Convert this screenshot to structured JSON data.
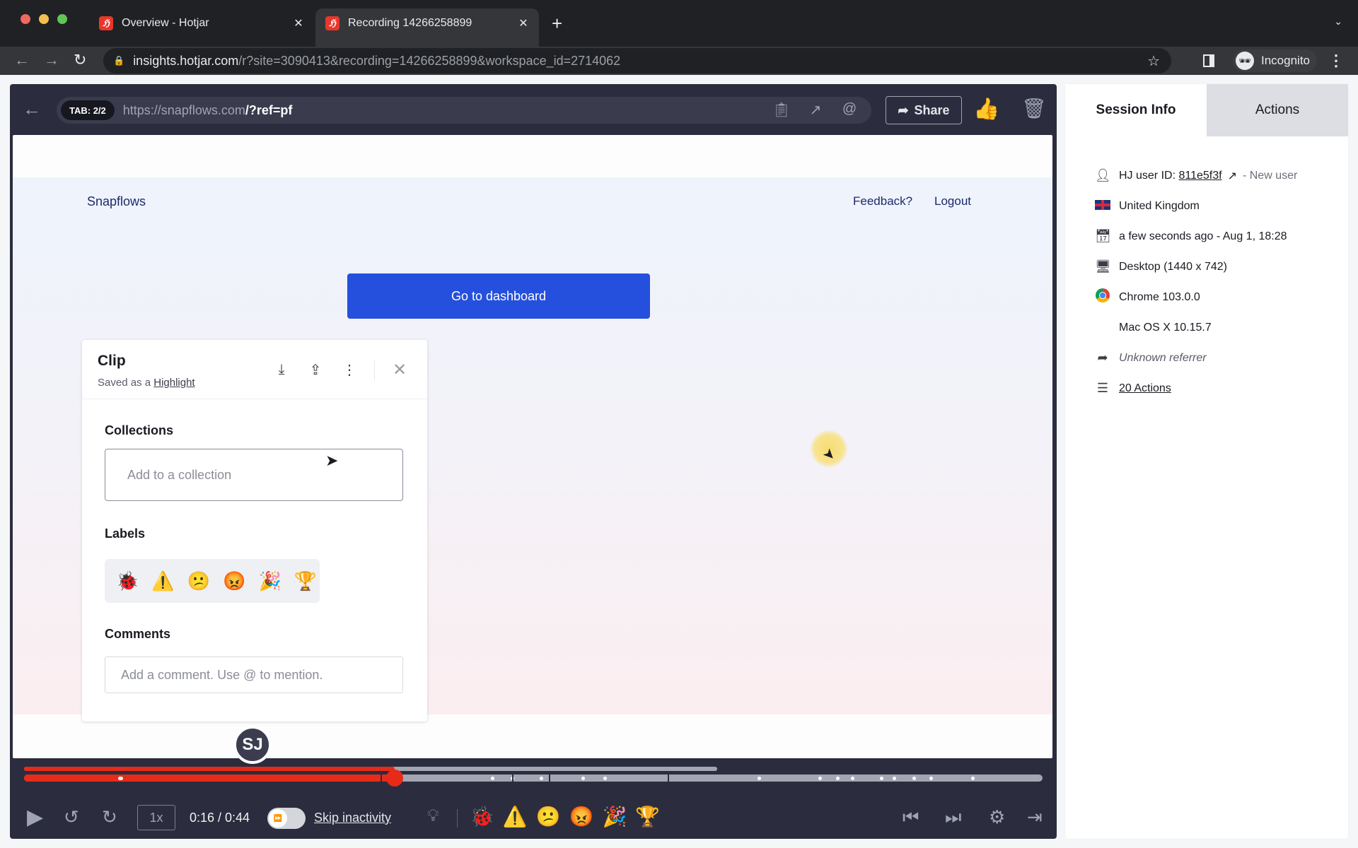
{
  "browser": {
    "tabs": [
      {
        "title": "Overview - Hotjar",
        "favicon": "hotjar-icon",
        "active": false
      },
      {
        "title": "Recording 14266258899",
        "favicon": "hotjar-icon",
        "active": true
      }
    ],
    "url_host": "insights.hotjar.com",
    "url_path": "/r?site=3090413&recording=14266258899&workspace_id=2714062",
    "profile_label": "Incognito"
  },
  "player": {
    "tab_indicator": "TAB: 2/2",
    "url_base": "https://snapflows.com",
    "url_query": "/?ref=pf",
    "share_label": "Share",
    "thumbs_up": "👍",
    "current_time": "0:16",
    "total_time": "0:44",
    "time_display": "0:16 / 0:44",
    "speed": "1x",
    "skip_inactivity_label": "Skip inactivity",
    "skip_inactivity_enabled": true,
    "progress_fraction": 0.3636,
    "visited_fraction": 0.25,
    "avatar_initials": "SJ",
    "label_emojis": [
      "🐞",
      "⚠️",
      "😕",
      "😡",
      "🎉",
      "🏆"
    ]
  },
  "site": {
    "logo": "Snapflows",
    "nav": [
      "Feedback?",
      "Logout"
    ],
    "cta": "Go to dashboard"
  },
  "clip": {
    "title": "Clip",
    "saved_prefix": "Saved as a",
    "saved_link": "Highlight",
    "collections_label": "Collections",
    "collections_placeholder": "Add to a collection",
    "labels_label": "Labels",
    "labels": [
      {
        "name": "bug",
        "emoji": "🐞"
      },
      {
        "name": "warning",
        "emoji": "⚠️"
      },
      {
        "name": "confused",
        "emoji": "😕"
      },
      {
        "name": "angry",
        "emoji": "😡"
      },
      {
        "name": "party",
        "emoji": "🎉"
      },
      {
        "name": "trophy",
        "emoji": "🏆"
      }
    ],
    "comments_label": "Comments",
    "comments_placeholder": "Add a comment. Use @ to mention."
  },
  "session": {
    "tabs": [
      "Session Info",
      "Actions"
    ],
    "active_tab": "Session Info",
    "user_id_label": "HJ user ID:",
    "user_id": "811e5f3f",
    "user_status": "- New user",
    "country": "United Kingdom",
    "date": "a few seconds ago - Aug 1, 18:28",
    "device": "Desktop (1440 x 742)",
    "browser": "Chrome 103.0.0",
    "os": "Mac OS X 10.15.7",
    "referrer": "Unknown referrer",
    "actions_link": "20 Actions"
  }
}
